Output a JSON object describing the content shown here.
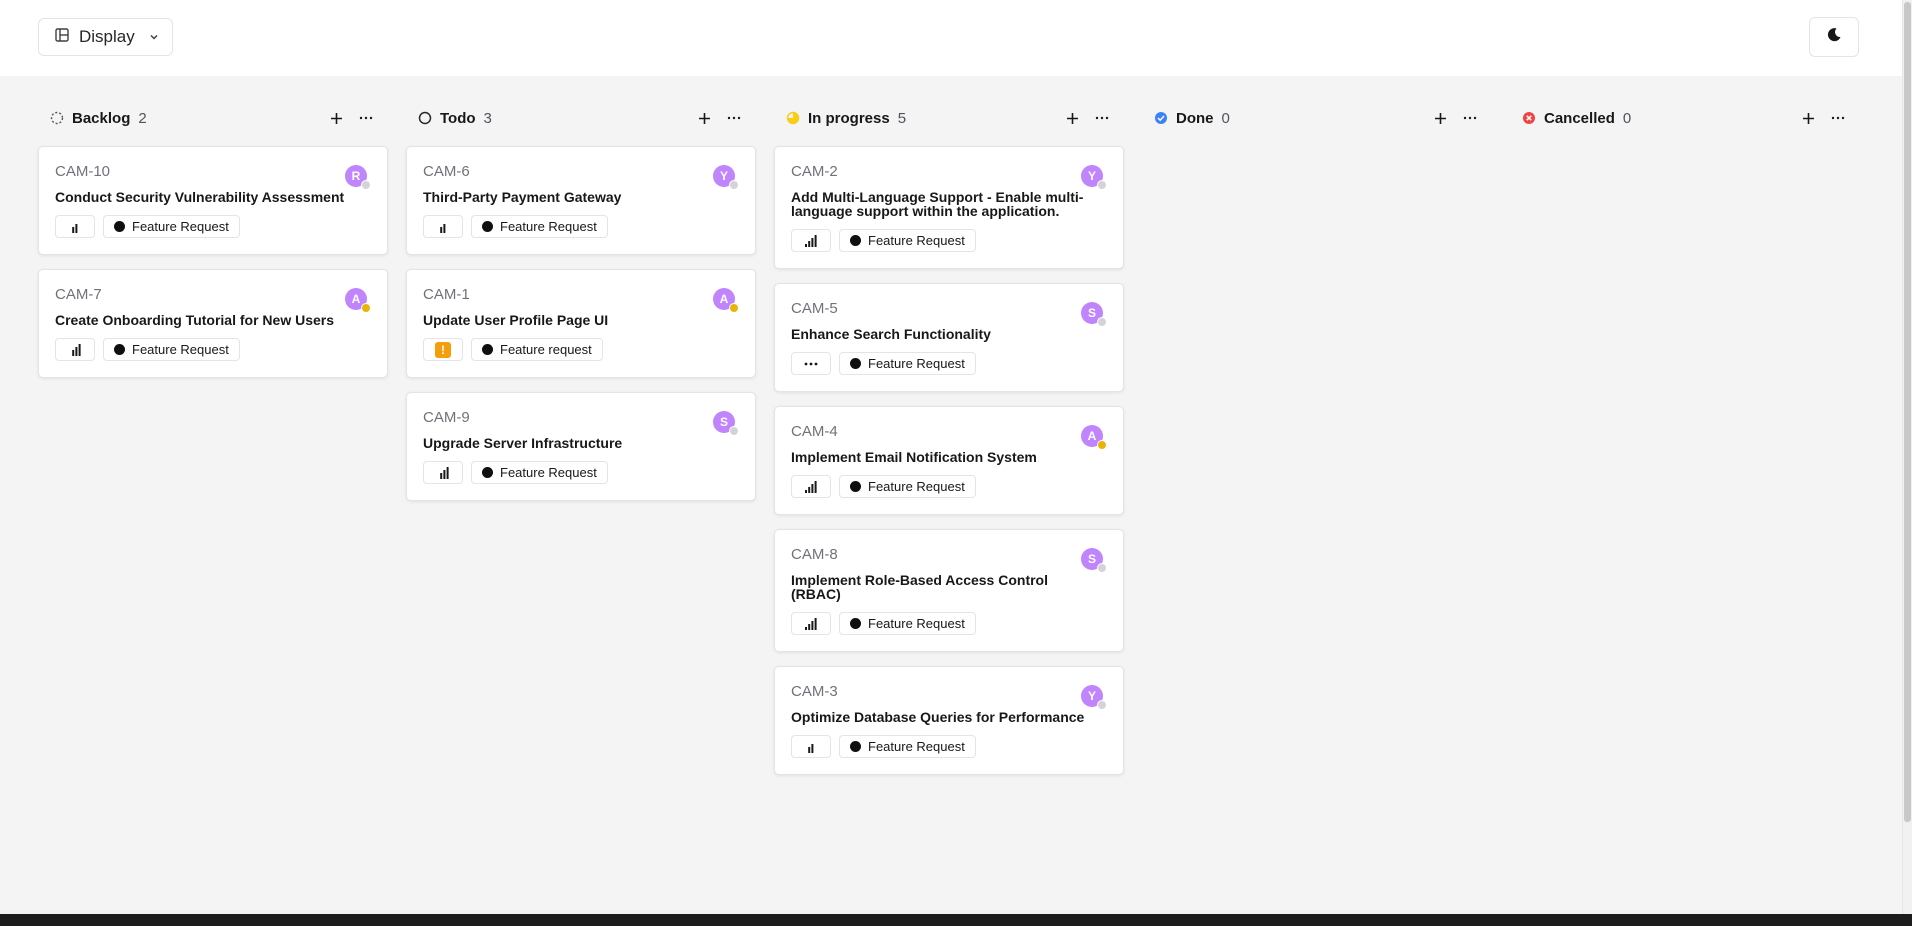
{
  "toolbar": {
    "display_label": "Display"
  },
  "columns": [
    {
      "name": "Backlog",
      "count": "2",
      "status": "backlog",
      "cards": [
        {
          "id": "CAM-10",
          "title": "Conduct Security Vulnerability Assessment",
          "priority": "low",
          "tag": "Feature Request",
          "avatar": "R",
          "presence": "#d4d4d8"
        },
        {
          "id": "CAM-7",
          "title": "Create Onboarding Tutorial for New Users",
          "priority": "high",
          "tag": "Feature Request",
          "avatar": "A",
          "presence": "#eab308"
        }
      ]
    },
    {
      "name": "Todo",
      "count": "3",
      "status": "todo",
      "cards": [
        {
          "id": "CAM-6",
          "title": "Third-Party Payment Gateway",
          "priority": "low",
          "tag": "Feature Request",
          "avatar": "Y",
          "presence": "#d4d4d8"
        },
        {
          "id": "CAM-1",
          "title": "Update User Profile Page UI",
          "priority": "urgent",
          "tag": "Feature request",
          "avatar": "A",
          "presence": "#eab308"
        },
        {
          "id": "CAM-9",
          "title": "Upgrade Server Infrastructure",
          "priority": "high",
          "tag": "Feature Request",
          "avatar": "S",
          "presence": "#d4d4d8"
        }
      ]
    },
    {
      "name": "In progress",
      "count": "5",
      "status": "in-progress",
      "cards": [
        {
          "id": "CAM-2",
          "title": "Add Multi-Language Support - Enable multi-language support within the application.",
          "priority": "medium",
          "tag": "Feature Request",
          "avatar": "Y",
          "presence": "#d4d4d8"
        },
        {
          "id": "CAM-5",
          "title": "Enhance Search Functionality",
          "priority": "none",
          "tag": "Feature Request",
          "avatar": "S",
          "presence": "#d4d4d8"
        },
        {
          "id": "CAM-4",
          "title": "Implement Email Notification System",
          "priority": "medium",
          "tag": "Feature Request",
          "avatar": "A",
          "presence": "#eab308"
        },
        {
          "id": "CAM-8",
          "title": "Implement Role-Based Access Control (RBAC)",
          "priority": "medium",
          "tag": "Feature Request",
          "avatar": "S",
          "presence": "#d4d4d8"
        },
        {
          "id": "CAM-3",
          "title": "Optimize Database Queries for Performance",
          "priority": "low",
          "tag": "Feature Request",
          "avatar": "Y",
          "presence": "#d4d4d8"
        }
      ]
    },
    {
      "name": "Done",
      "count": "0",
      "status": "done",
      "cards": []
    },
    {
      "name": "Cancelled",
      "count": "0",
      "status": "cancelled",
      "cards": []
    }
  ],
  "colors": {
    "avatar": "#c084fc",
    "in_progress": "#facc15",
    "done": "#3b82f6",
    "cancelled": "#ef4444",
    "urgent": "#f59e0b"
  },
  "icons": {
    "display": "layout-icon",
    "theme": "moon-icon",
    "add": "plus-icon",
    "more": "ellipsis-icon"
  }
}
